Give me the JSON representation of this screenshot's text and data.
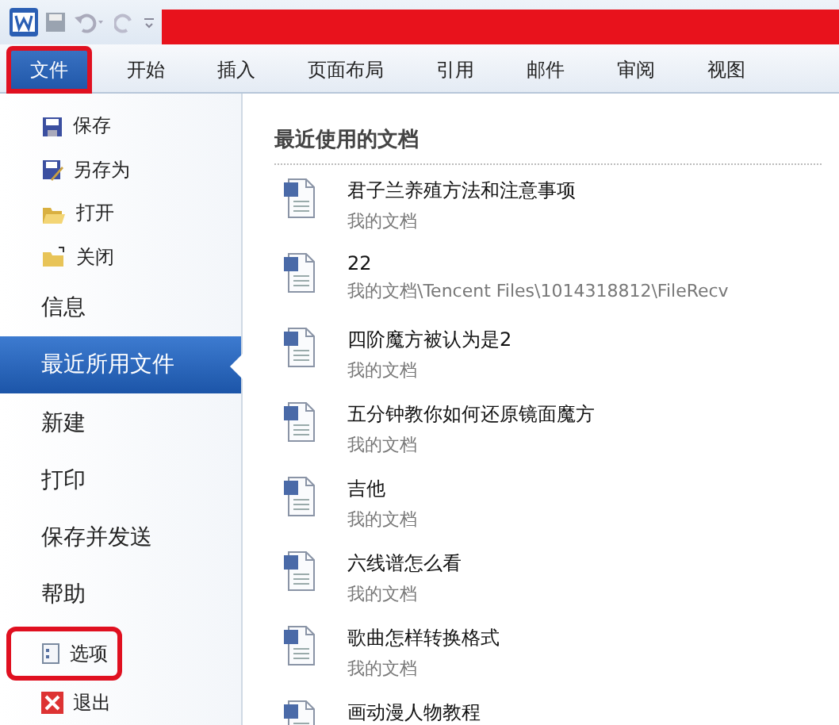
{
  "ribbon_tabs": [
    {
      "label": "文件",
      "selected": true,
      "annotated": true
    },
    {
      "label": "开始",
      "selected": false
    },
    {
      "label": "插入",
      "selected": false
    },
    {
      "label": "页面布局",
      "selected": false
    },
    {
      "label": "引用",
      "selected": false
    },
    {
      "label": "邮件",
      "selected": false
    },
    {
      "label": "审阅",
      "selected": false
    },
    {
      "label": "视图",
      "selected": false
    }
  ],
  "backstage_menu": [
    {
      "kind": "command",
      "label": "保存"
    },
    {
      "kind": "command",
      "label": "另存为"
    },
    {
      "kind": "command",
      "label": "打开"
    },
    {
      "kind": "command",
      "label": "关闭"
    },
    {
      "kind": "section",
      "label": "信息",
      "selected": false
    },
    {
      "kind": "section",
      "label": "最近所用文件",
      "selected": true
    },
    {
      "kind": "section",
      "label": "新建",
      "selected": false
    },
    {
      "kind": "section",
      "label": "打印",
      "selected": false
    },
    {
      "kind": "section",
      "label": "保存并发送",
      "selected": false
    },
    {
      "kind": "section",
      "label": "帮助",
      "selected": false
    },
    {
      "kind": "command",
      "label": "选项",
      "annotated": true
    },
    {
      "kind": "command",
      "label": "退出"
    }
  ],
  "recent_documents": {
    "title": "最近使用的文档",
    "items": [
      {
        "name": "君子兰养殖方法和注意事项",
        "path": "我的文档"
      },
      {
        "name": "22",
        "path": "我的文档\\Tencent Files\\1014318812\\FileRecv"
      },
      {
        "name": "四阶魔方被认为是2",
        "path": "我的文档"
      },
      {
        "name": "五分钟教你如何还原镜面魔方",
        "path": "我的文档"
      },
      {
        "name": "吉他",
        "path": "我的文档"
      },
      {
        "name": "六线谱怎么看",
        "path": "我的文档"
      },
      {
        "name": "歌曲怎样转换格式",
        "path": "我的文档"
      },
      {
        "name": "画动漫人物教程"
      }
    ]
  }
}
